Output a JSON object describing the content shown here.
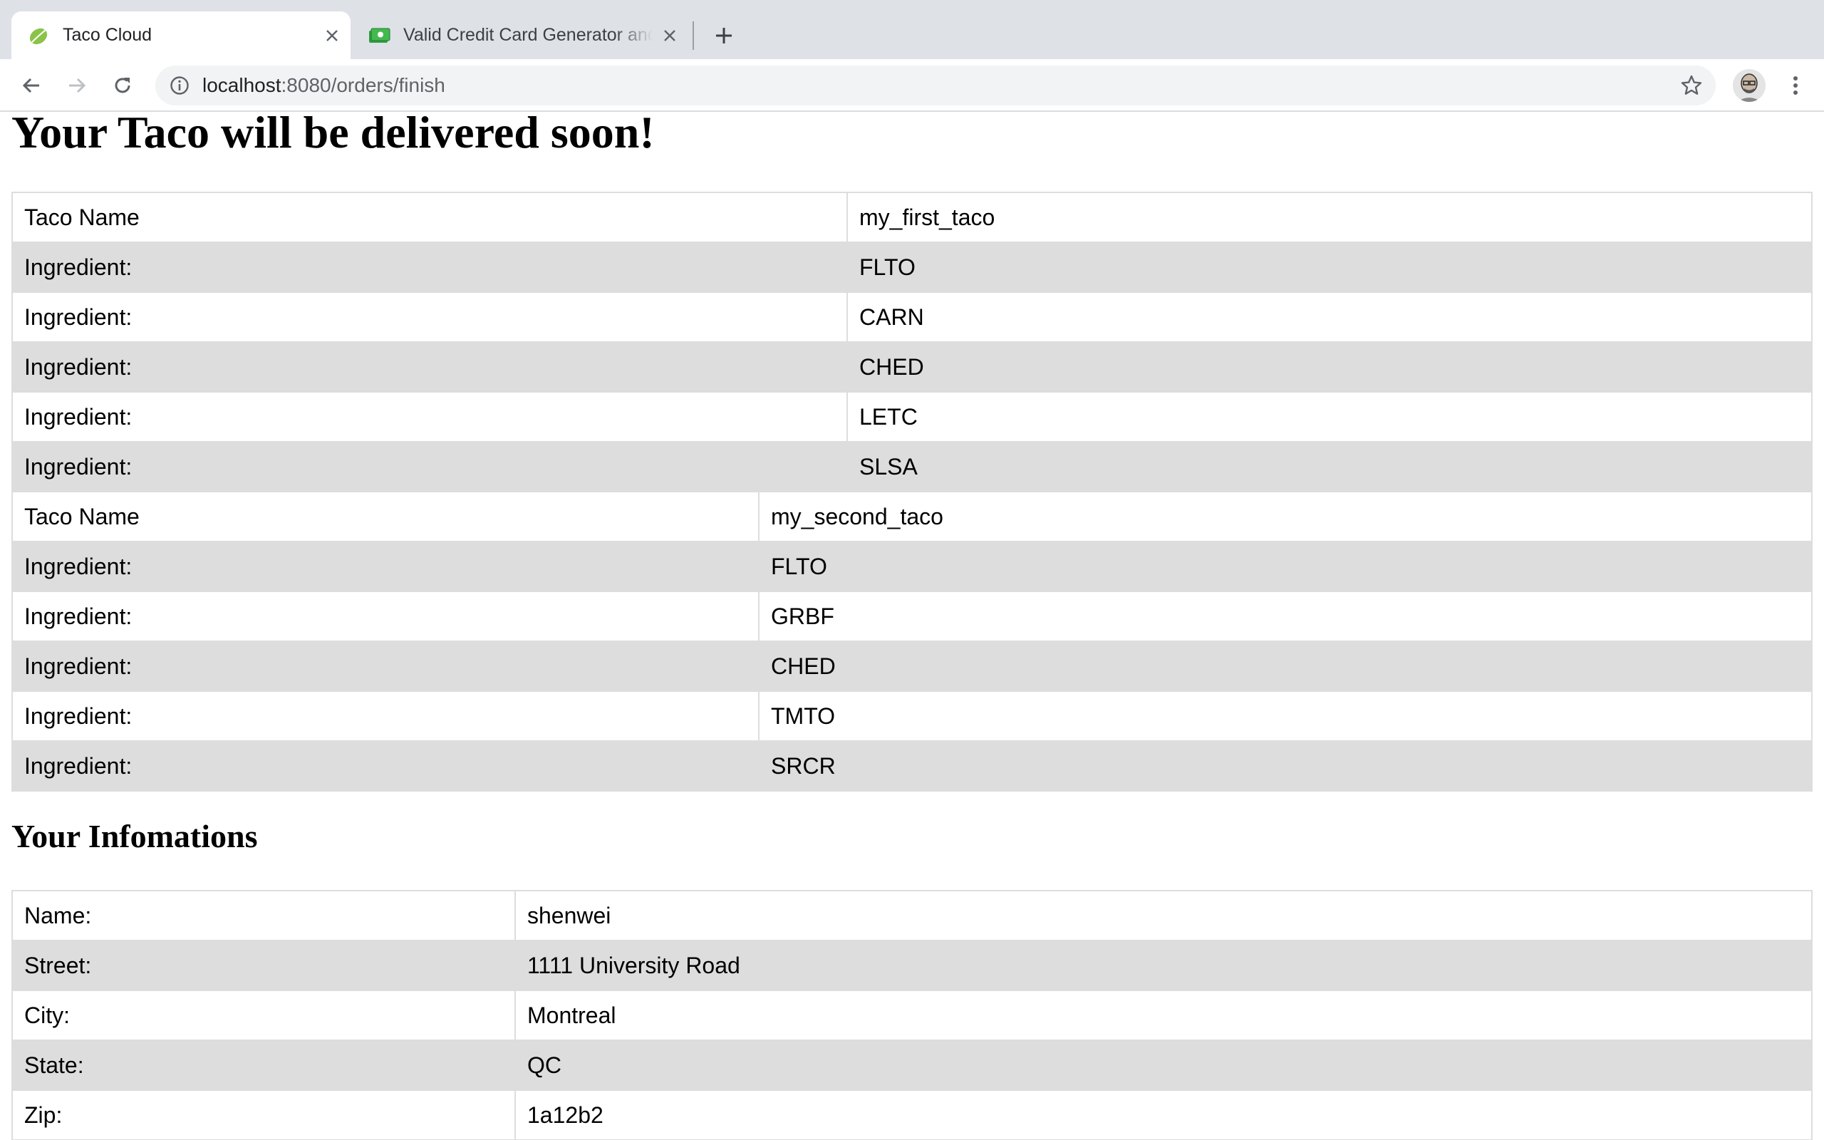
{
  "browser": {
    "tabs": [
      {
        "title": "Taco Cloud",
        "favicon": "spring-leaf-icon",
        "active": true
      },
      {
        "title": "Valid Credit Card Generator and",
        "favicon": "credit-card-icon",
        "active": false
      }
    ],
    "address_bar": {
      "host": "localhost",
      "path": ":8080/orders/finish"
    }
  },
  "page": {
    "title": "Your Taco will be delivered soon!",
    "tacos": [
      {
        "name_label": "Taco Name",
        "name": "my_first_taco",
        "ingredient_label": "Ingredient:",
        "ingredients": [
          "FLTO",
          "CARN",
          "CHED",
          "LETC",
          "SLSA"
        ]
      },
      {
        "name_label": "Taco Name",
        "name": "my_second_taco",
        "ingredient_label": "Ingredient:",
        "ingredients": [
          "FLTO",
          "GRBF",
          "CHED",
          "TMTO",
          "SRCR"
        ]
      }
    ],
    "info_title": "Your Infomations",
    "info": [
      {
        "label": "Name:",
        "value": "shenwei"
      },
      {
        "label": "Street:",
        "value": "1111 University Road"
      },
      {
        "label": "City:",
        "value": "Montreal"
      },
      {
        "label": "State:",
        "value": "QC"
      },
      {
        "label": "Zip:",
        "value": "1a12b2"
      }
    ]
  },
  "colors": {
    "row_alt": "#dddddd",
    "tabstrip": "#dee1e6",
    "omnibox": "#f1f3f4"
  }
}
